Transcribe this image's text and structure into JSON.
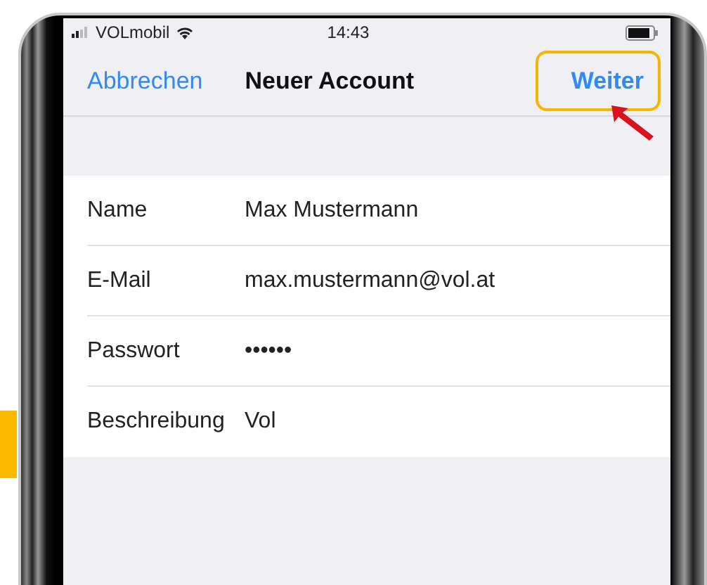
{
  "status_bar": {
    "carrier": "VOLmobil",
    "time": "14:43"
  },
  "nav_bar": {
    "cancel": "Abbrechen",
    "title": "Neuer Account",
    "next": {
      "label": "Weiter",
      "highlighted": true
    }
  },
  "form": [
    {
      "label": "Name",
      "value": "Max Mustermann"
    },
    {
      "label": "E-Mail",
      "value": "max.mustermann@vol.at"
    },
    {
      "label": "Passwort",
      "value": "••••••"
    },
    {
      "label": "Beschreibung",
      "value": "Vol"
    }
  ]
}
